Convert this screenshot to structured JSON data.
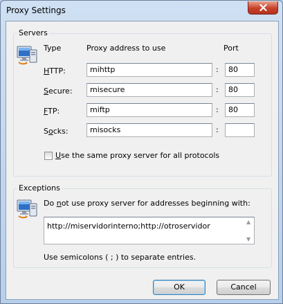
{
  "window": {
    "title": "Proxy Settings"
  },
  "servers": {
    "group_label": "Servers",
    "col_type": "Type",
    "col_address": "Proxy address to use",
    "col_port": "Port",
    "rows": [
      {
        "label_pre": "",
        "label_ul": "H",
        "label_post": "TTP:",
        "address": "mihttp",
        "port": "80"
      },
      {
        "label_pre": "",
        "label_ul": "S",
        "label_post": "ecure:",
        "address": "misecure",
        "port": "80"
      },
      {
        "label_pre": "",
        "label_ul": "F",
        "label_post": "TP:",
        "address": "miftp",
        "port": "80"
      },
      {
        "label_pre": "S",
        "label_ul": "o",
        "label_post": "cks:",
        "address": "misocks",
        "port": ""
      }
    ],
    "colon": ":",
    "same_proxy": {
      "ul": "U",
      "rest": "se the same proxy server for all protocols",
      "checked": false
    }
  },
  "exceptions": {
    "group_label": "Exceptions",
    "desc_pre": "Do ",
    "desc_ul": "n",
    "desc_post": "ot use proxy server for addresses beginning with:",
    "value": "http://miservidorinterno;http://otroservidor",
    "hint": "Use semicolons ( ; ) to separate entries."
  },
  "buttons": {
    "ok": "OK",
    "cancel": "Cancel"
  },
  "icons": {
    "close": "close-icon",
    "computer": "computer-network-icon"
  }
}
